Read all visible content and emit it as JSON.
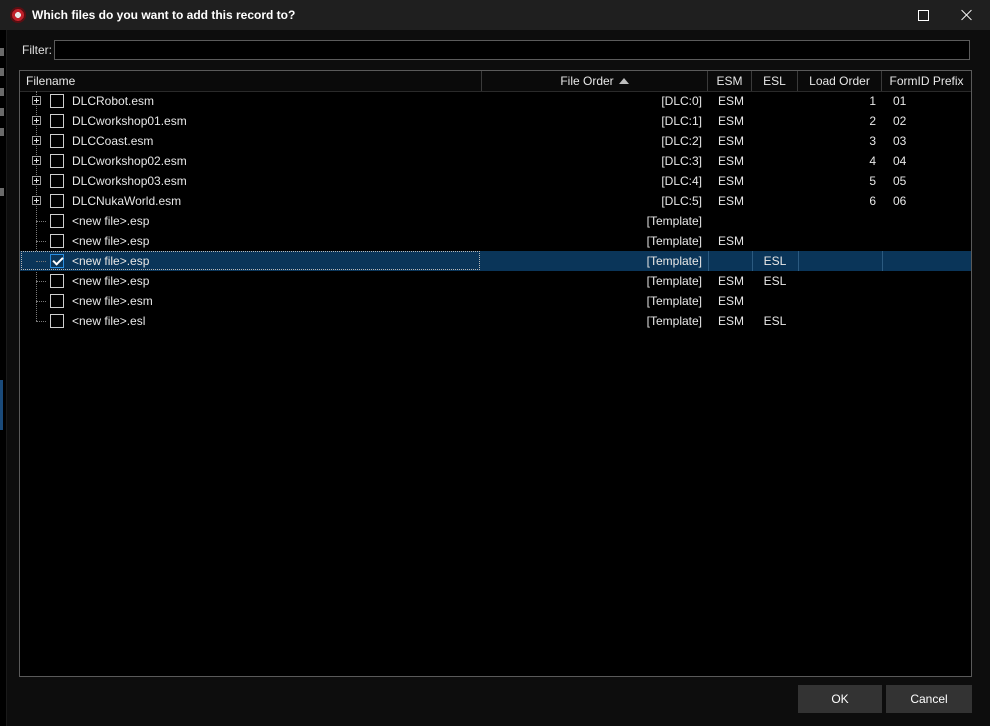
{
  "window": {
    "title": "Which files do you want to add this record to?",
    "app_icon": "xedit-icon"
  },
  "filter": {
    "label": "Filter:",
    "value": ""
  },
  "list": {
    "columns": {
      "filename": "Filename",
      "file_order": "File Order",
      "esm": "ESM",
      "esl": "ESL",
      "load_order": "Load Order",
      "formid_prefix": "FormID Prefix"
    },
    "sort_column": "file_order",
    "sort_direction": "ascending",
    "rows": [
      {
        "name": "DLCRobot.esm",
        "order": "[DLC:0]",
        "esm": "ESM",
        "esl": "",
        "load": "1",
        "prefix": "01",
        "expandable": true,
        "checked": false,
        "selected": false
      },
      {
        "name": "DLCworkshop01.esm",
        "order": "[DLC:1]",
        "esm": "ESM",
        "esl": "",
        "load": "2",
        "prefix": "02",
        "expandable": true,
        "checked": false,
        "selected": false
      },
      {
        "name": "DLCCoast.esm",
        "order": "[DLC:2]",
        "esm": "ESM",
        "esl": "",
        "load": "3",
        "prefix": "03",
        "expandable": true,
        "checked": false,
        "selected": false
      },
      {
        "name": "DLCworkshop02.esm",
        "order": "[DLC:3]",
        "esm": "ESM",
        "esl": "",
        "load": "4",
        "prefix": "04",
        "expandable": true,
        "checked": false,
        "selected": false
      },
      {
        "name": "DLCworkshop03.esm",
        "order": "[DLC:4]",
        "esm": "ESM",
        "esl": "",
        "load": "5",
        "prefix": "05",
        "expandable": true,
        "checked": false,
        "selected": false
      },
      {
        "name": "DLCNukaWorld.esm",
        "order": "[DLC:5]",
        "esm": "ESM",
        "esl": "",
        "load": "6",
        "prefix": "06",
        "expandable": true,
        "checked": false,
        "selected": false
      },
      {
        "name": "<new file>.esp",
        "order": "[Template]",
        "esm": "",
        "esl": "",
        "load": "",
        "prefix": "",
        "expandable": false,
        "checked": false,
        "selected": false
      },
      {
        "name": "<new file>.esp",
        "order": "[Template]",
        "esm": "ESM",
        "esl": "",
        "load": "",
        "prefix": "",
        "expandable": false,
        "checked": false,
        "selected": false
      },
      {
        "name": "<new file>.esp",
        "order": "[Template]",
        "esm": "",
        "esl": "ESL",
        "load": "",
        "prefix": "",
        "expandable": false,
        "checked": true,
        "selected": true
      },
      {
        "name": "<new file>.esp",
        "order": "[Template]",
        "esm": "ESM",
        "esl": "ESL",
        "load": "",
        "prefix": "",
        "expandable": false,
        "checked": false,
        "selected": false
      },
      {
        "name": "<new file>.esm",
        "order": "[Template]",
        "esm": "ESM",
        "esl": "",
        "load": "",
        "prefix": "",
        "expandable": false,
        "checked": false,
        "selected": false
      },
      {
        "name": "<new file>.esl",
        "order": "[Template]",
        "esm": "ESM",
        "esl": "ESL",
        "load": "",
        "prefix": "",
        "expandable": false,
        "checked": false,
        "selected": false
      }
    ]
  },
  "buttons": {
    "ok": "OK",
    "cancel": "Cancel"
  },
  "colors": {
    "selection": "#0a3559",
    "checkbox_checked": "#2a8ee0",
    "button_bg": "#333333"
  }
}
